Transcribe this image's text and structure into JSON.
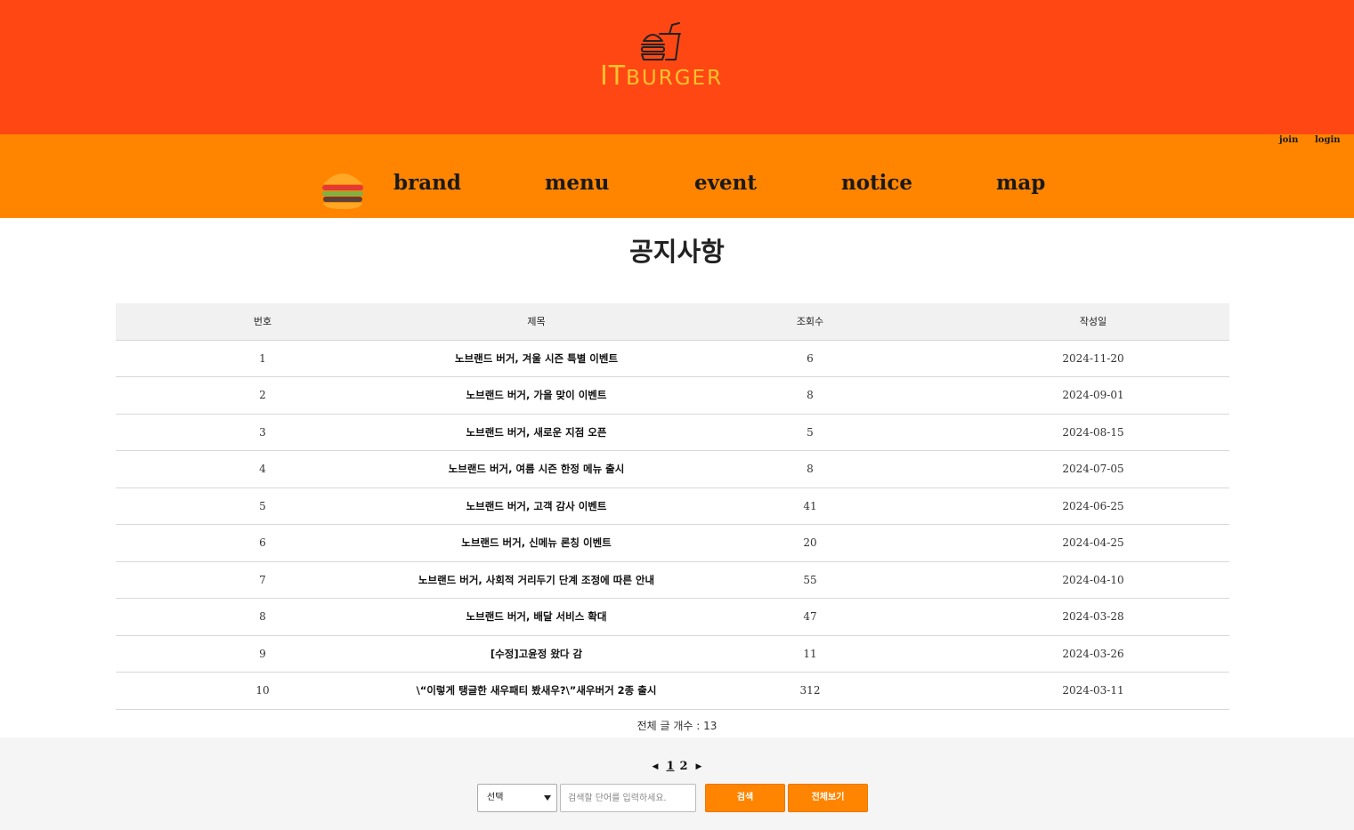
{
  "brand": {
    "logo_it": "IT",
    "logo_burger": "BURGER"
  },
  "auth": {
    "join": "join",
    "login": "login"
  },
  "nav": {
    "items": [
      "brand",
      "menu",
      "event",
      "notice",
      "map"
    ]
  },
  "page_title": "공지사항",
  "table": {
    "headers": [
      "번호",
      "제목",
      "조회수",
      "작성일"
    ],
    "rows": [
      {
        "no": "1",
        "title": "노브랜드 버거, 겨울 시즌 특별 이벤트",
        "views": "6",
        "date": "2024-11-20"
      },
      {
        "no": "2",
        "title": "노브랜드 버거, 가을 맞이 이벤트",
        "views": "8",
        "date": "2024-09-01"
      },
      {
        "no": "3",
        "title": "노브랜드 버거, 새로운 지점 오픈",
        "views": "5",
        "date": "2024-08-15"
      },
      {
        "no": "4",
        "title": "노브랜드 버거, 여름 시즌 한정 메뉴 출시",
        "views": "8",
        "date": "2024-07-05"
      },
      {
        "no": "5",
        "title": "노브랜드 버거, 고객 감사 이벤트",
        "views": "41",
        "date": "2024-06-25"
      },
      {
        "no": "6",
        "title": "노브랜드 버거, 신메뉴 론칭 이벤트",
        "views": "20",
        "date": "2024-04-25"
      },
      {
        "no": "7",
        "title": "노브랜드 버거, 사회적 거리두기 단계 조정에 따른 안내",
        "views": "55",
        "date": "2024-04-10"
      },
      {
        "no": "8",
        "title": "노브랜드 버거, 배달 서비스 확대",
        "views": "47",
        "date": "2024-03-28"
      },
      {
        "no": "9",
        "title": "[수정]고윤정 왔다 감",
        "views": "11",
        "date": "2024-03-26"
      },
      {
        "no": "10",
        "title": "\\“이렇게 탱글한 새우패티 봤새우?\\”새우버거 2종 출시",
        "views": "312",
        "date": "2024-03-11"
      }
    ]
  },
  "total": {
    "label": "전체 글 개수 : ",
    "count": "13"
  },
  "pager": {
    "pages": [
      "1",
      "2"
    ],
    "current": "1"
  },
  "search": {
    "select_value": "선택",
    "placeholder": "검색할 단어를 입력하세요.",
    "search_label": "검색",
    "view_all_label": "전체보기"
  }
}
